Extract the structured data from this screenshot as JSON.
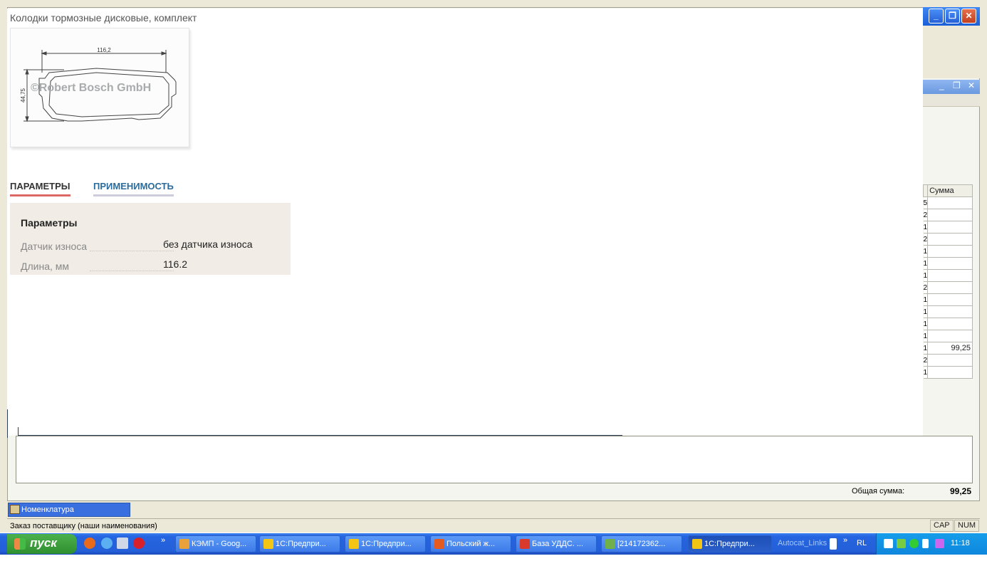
{
  "web": {
    "product_title": "Колодки тормозные дисковые, комплект",
    "drawing": {
      "dimension_width": "116,2",
      "dimension_height": "44,75",
      "watermark": "©Robert Bosch GmbH"
    },
    "tabs": [
      {
        "label": "ПАРАМЕТРЫ",
        "active": true
      },
      {
        "label": "ПРИМЕНИМОСТЬ",
        "active": false
      }
    ],
    "params": {
      "heading": "Параметры",
      "rows": [
        {
          "name": "Датчик износа",
          "value": "без датчика износа"
        },
        {
          "name": "Длина, мм",
          "value": "116.2"
        }
      ]
    }
  },
  "onec": {
    "caption_buttons": {
      "minimize": "_",
      "restore": "❐",
      "close": "✕"
    },
    "sub_caption_buttons": {
      "minimize": "_",
      "restore": "❐",
      "close": "✕"
    },
    "table": {
      "column_header": "Сумма",
      "edge_marks": [
        "5",
        "2",
        "1",
        "2",
        "1",
        "1",
        "1",
        "2",
        "1",
        "1",
        "1",
        "1",
        "1",
        "2",
        "1"
      ],
      "values": [
        "",
        "",
        "",
        "",
        "",
        "",
        "",
        "",
        "",
        "",
        "",
        "",
        "99,25",
        "",
        ""
      ]
    },
    "total_label": "Общая сумма:",
    "total_value": "99,25",
    "window_tab": "Номенклатура",
    "status_text": "Заказ поставщику (наши наименования)",
    "indicators": {
      "cap": "CAP",
      "num": "NUM"
    }
  },
  "taskbar": {
    "start_label": "пуск",
    "chevron": "»",
    "buttons": [
      {
        "label": "КЭМП - Goog...",
        "icon_color": "#e9a23b"
      },
      {
        "label": "1С:Предпри...",
        "icon_color": "#f3c515"
      },
      {
        "label": "1С:Предпри...",
        "icon_color": "#f3c515"
      },
      {
        "label": "Польский ж...",
        "icon_color": "#e55b1f"
      },
      {
        "label": "База УДДС. ...",
        "icon_color": "#d93a2b"
      },
      {
        "label": "[214172362...",
        "icon_color": "#6fb04a"
      },
      {
        "label": "1С:Предпри...",
        "icon_color": "#f3c515"
      }
    ],
    "toolbar_label": "Autocat_Links",
    "language": "RL",
    "clock": "11:18"
  }
}
